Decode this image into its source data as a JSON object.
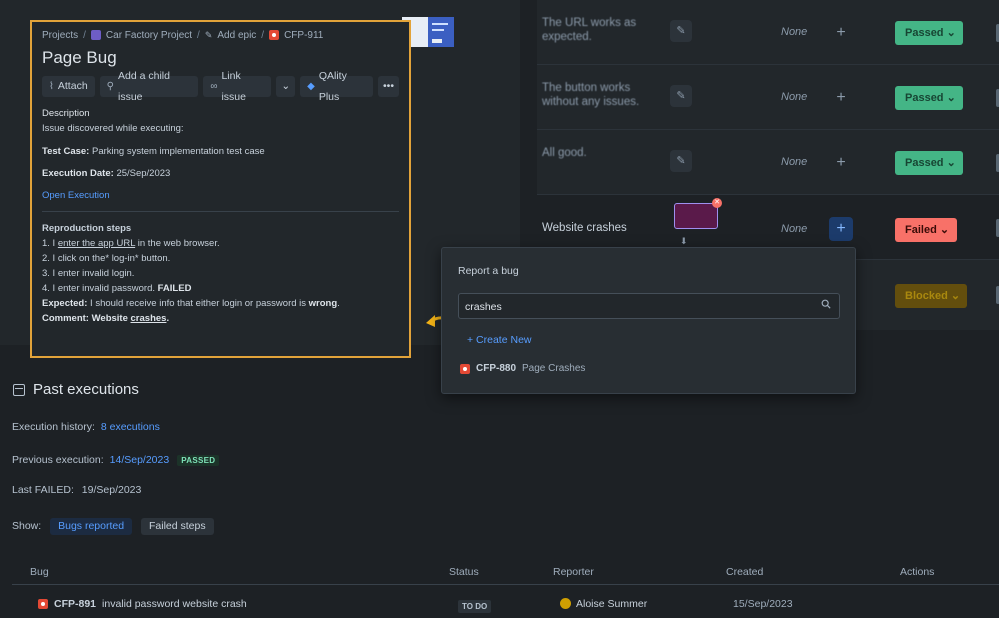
{
  "bug": {
    "breadcrumbs": [
      "Projects",
      "Car Factory Project",
      "Add epic",
      "CFP-911"
    ],
    "title": "Page Bug",
    "toolbar": {
      "attach": "Attach",
      "add_child": "Add a child issue",
      "link_issue": "Link issue",
      "qality": "QAlity Plus",
      "more": "•••"
    },
    "description": {
      "label": "Description",
      "intro": "Issue discovered while executing:",
      "test_case_label": "Test Case:",
      "test_case": "Parking system implementation test case",
      "exec_date_label": "Execution Date:",
      "exec_date": "25/Sep/2023",
      "open_execution": "Open Execution",
      "repro_label": "Reproduction steps",
      "step1_a": "1. I ",
      "step1_link": "enter the app URL",
      "step1_b": " in the web browser.",
      "step2": "2. I click on the* log-in* button.",
      "step3": "3. I enter invalid login.",
      "step4_a": "4. I enter invalid password. ",
      "step4_b": "FAILED",
      "expected_label": "Expected:",
      "expected_a": " I should receive info that either login or password is ",
      "expected_b": "wrong",
      "expected_c": ".",
      "comment_label": "Comment: Website ",
      "comment_link": "crashes",
      "comment_end": "."
    }
  },
  "steps": [
    {
      "text": "The URL works as expected.",
      "none": "None",
      "status": "Passed"
    },
    {
      "text": "The button works without any issues.",
      "none": "None",
      "status": "Passed"
    },
    {
      "text": "All good.",
      "none": "None",
      "status": "Passed"
    },
    {
      "text": "Website crashes",
      "none": "None",
      "status": "Failed"
    },
    {
      "text": "",
      "none": "",
      "status": "Blocked"
    }
  ],
  "report": {
    "title": "Report a bug",
    "search_value": "crashes",
    "create_new": "+ Create New",
    "result_key": "CFP-880",
    "result_title": "Page Crashes"
  },
  "past": {
    "title": "Past executions",
    "history_label": "Execution history:",
    "history_link": "8 executions",
    "previous_label": "Previous execution:",
    "previous_link": "14/Sep/2023",
    "previous_badge": "PASSED",
    "last_failed_label": "Last FAILED:",
    "last_failed_value": "19/Sep/2023",
    "show_label": "Show:",
    "show_bugs": "Bugs reported",
    "show_failed": "Failed steps"
  },
  "table": {
    "headers": [
      "Bug",
      "Status",
      "Reporter",
      "Created",
      "Actions"
    ],
    "row": {
      "key": "CFP-891",
      "title": "invalid password website crash",
      "status": "TO DO",
      "reporter": "Aloise Summer",
      "created": "15/Sep/2023"
    }
  },
  "colors": {
    "accent_link": "#579dff",
    "highlight_border": "#e2a33a",
    "passed": "#4bce97",
    "failed": "#f87168",
    "blocked": "#e2b203"
  }
}
